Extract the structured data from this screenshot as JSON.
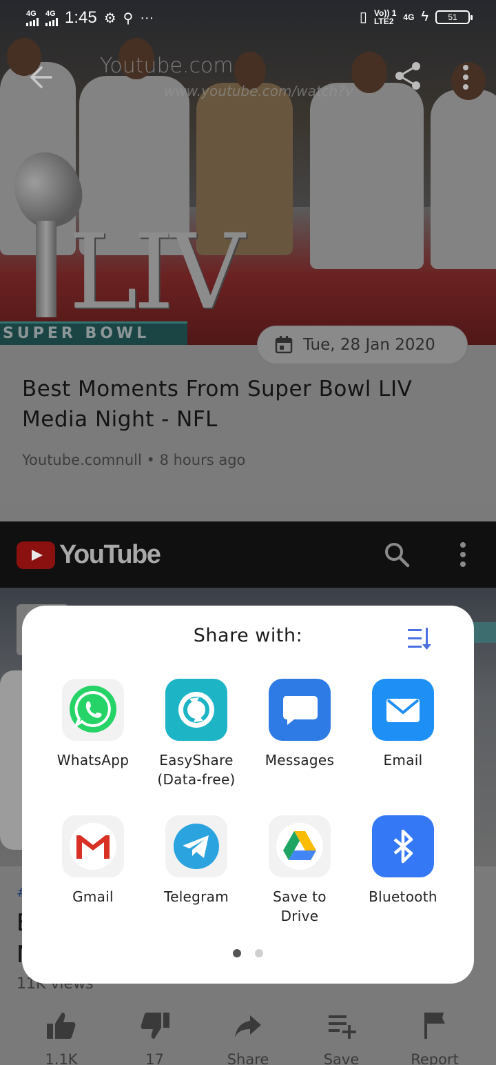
{
  "status_bar": {
    "time": "1:45",
    "sim1_label": "4G",
    "sim2_label": "4G",
    "right_label_volte": "Vo)) 1",
    "right_label_lte": "LTE2",
    "right_label_4g": "4G",
    "battery": "51"
  },
  "top_card": {
    "watermark_site": "Youtube.com",
    "watermark_url": "www.youtube.com/watch?v",
    "banner_text": "SUPER BOWL",
    "trophy_text": "LIV",
    "date": "Tue, 28 Jan 2020",
    "title": "Best Moments From Super Bowl LIV Media Night - NFL",
    "source": "Youtube.comnull",
    "separator": "•",
    "age": "8 hours ago"
  },
  "youtube": {
    "logo_text": "YouTube",
    "hash_tag": "#",
    "title_line1": "B",
    "title_line2": "M",
    "views": "11K views",
    "actions": [
      {
        "label": "1.1K",
        "icon": "thumbs-up-icon"
      },
      {
        "label": "17",
        "icon": "thumbs-down-icon"
      },
      {
        "label": "Share",
        "icon": "share-arrow-icon"
      },
      {
        "label": "Save",
        "icon": "playlist-add-icon"
      },
      {
        "label": "Report",
        "icon": "flag-icon"
      }
    ]
  },
  "share_sheet": {
    "title": "Share with:",
    "apps": [
      {
        "label": "WhatsApp",
        "icon": "whatsapp-icon",
        "color": "#25D366"
      },
      {
        "label": "EasyShare\n(Data-free)",
        "icon": "easyshare-icon",
        "color": "#1DB4C6"
      },
      {
        "label": "Messages",
        "icon": "messages-icon",
        "color": "#2E7BE6"
      },
      {
        "label": "Email",
        "icon": "email-icon",
        "color": "#1E90F5"
      },
      {
        "label": "Gmail",
        "icon": "gmail-icon",
        "color": "#D93025"
      },
      {
        "label": "Telegram",
        "icon": "telegram-icon",
        "color": "#2AA3DF"
      },
      {
        "label": "Save to\nDrive",
        "icon": "google-drive-icon",
        "color": "#1FA463"
      },
      {
        "label": "Bluetooth",
        "icon": "bluetooth-icon",
        "color": "#3478F6"
      }
    ],
    "page_count": 2,
    "active_page": 0
  }
}
